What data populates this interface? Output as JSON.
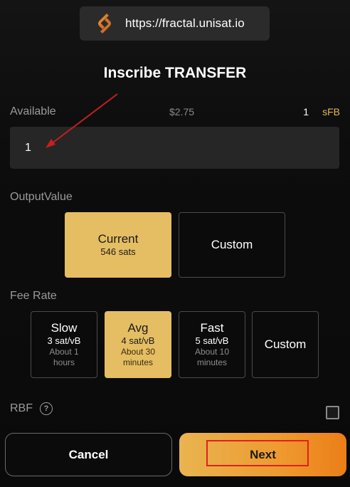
{
  "origin": {
    "url": "https://fractal.unisat.io",
    "logo_icon": "unisat-logo-icon"
  },
  "title": "Inscribe TRANSFER",
  "available": {
    "label": "Available",
    "usd": "$2.75",
    "amount": "1",
    "unit": "sFB"
  },
  "amount_input": {
    "value": "1"
  },
  "output_value": {
    "label": "OutputValue",
    "options": [
      {
        "title": "Current",
        "sub": "546 sats",
        "selected": true
      },
      {
        "title": "Custom",
        "selected": false
      }
    ]
  },
  "fee_rate": {
    "label": "Fee Rate",
    "options": [
      {
        "title": "Slow",
        "rate": "3 sat/vB",
        "time": "About 1 hours",
        "selected": false
      },
      {
        "title": "Avg",
        "rate": "4 sat/vB",
        "time": "About 30 minutes",
        "selected": true
      },
      {
        "title": "Fast",
        "rate": "5 sat/vB",
        "time": "About 10 minutes",
        "selected": false
      },
      {
        "title": "Custom",
        "selected": false
      }
    ]
  },
  "rbf": {
    "label": "RBF",
    "checked": false
  },
  "buttons": {
    "cancel": "Cancel",
    "next": "Next"
  },
  "colors": {
    "accent": "#e5bd63",
    "next_gradient_end": "#ec7e17",
    "highlight": "#e02020"
  }
}
